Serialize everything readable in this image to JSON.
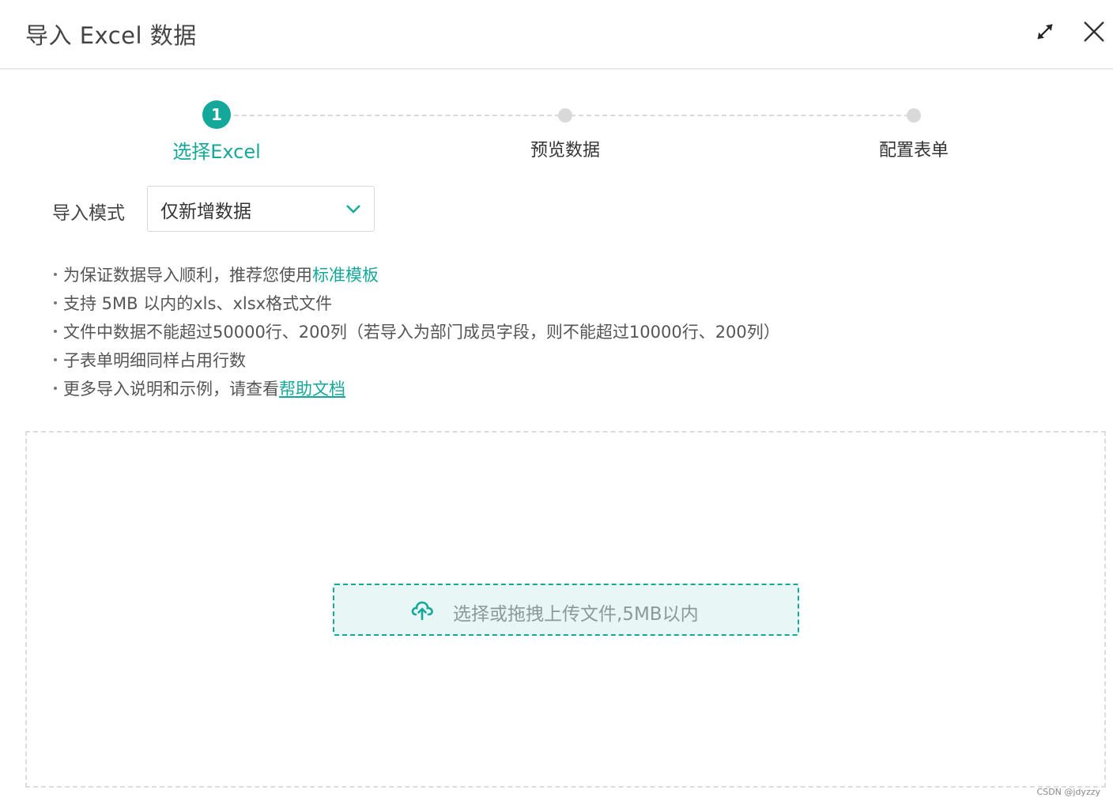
{
  "dialog": {
    "title": "导入 Excel 数据"
  },
  "steps": [
    {
      "number": "1",
      "label": "选择Excel",
      "state": "active"
    },
    {
      "label": "预览数据",
      "state": "pending"
    },
    {
      "label": "配置表单",
      "state": "pending"
    }
  ],
  "import_mode": {
    "label": "导入模式",
    "selected": "仅新增数据"
  },
  "tips": {
    "tip1_text": "为保证数据导入顺利，推荐您使用",
    "tip1_link": "标准模板",
    "tip2": "支持 5MB 以内的xls、xlsx格式文件",
    "tip3": "文件中数据不能超过50000行、200列（若导入为部门成员字段，则不能超过10000行、200列）",
    "tip4": "子表单明细同样占用行数",
    "tip5_text": "更多导入说明和示例，请查看",
    "tip5_link": "帮助文档"
  },
  "upload": {
    "label": "选择或拖拽上传文件,5MB以内",
    "icon": "cloud-upload-icon"
  },
  "watermark": "CSDN @jdyzzy",
  "colors": {
    "accent": "#14a89a",
    "upload_bg": "#e8f6f5"
  }
}
